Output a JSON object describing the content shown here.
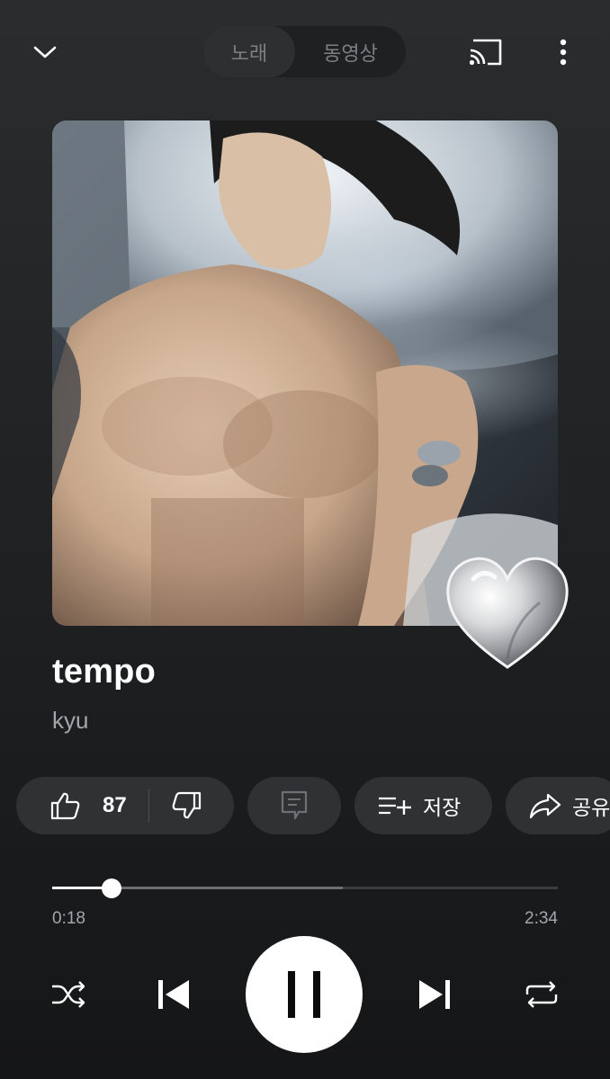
{
  "header": {
    "tabs": [
      {
        "label": "노래",
        "active": true
      },
      {
        "label": "동영상",
        "active": false
      }
    ],
    "icons": {
      "collapse": "chevron-down-icon",
      "cast": "cast-icon",
      "more": "more-vertical-icon"
    }
  },
  "track": {
    "title": "tempo",
    "artist": "kyu"
  },
  "actions": {
    "like_count": "87",
    "save_label": "저장",
    "share_label": "공유"
  },
  "playback": {
    "elapsed": "0:18",
    "total": "2:34",
    "progress_fraction": 0.117,
    "buffered_fraction": 0.575,
    "state": "playing"
  },
  "colors": {
    "background": "#202224",
    "chip": "#2f3133",
    "accent": "#ffffff",
    "muted_text": "#a4a6a9"
  }
}
